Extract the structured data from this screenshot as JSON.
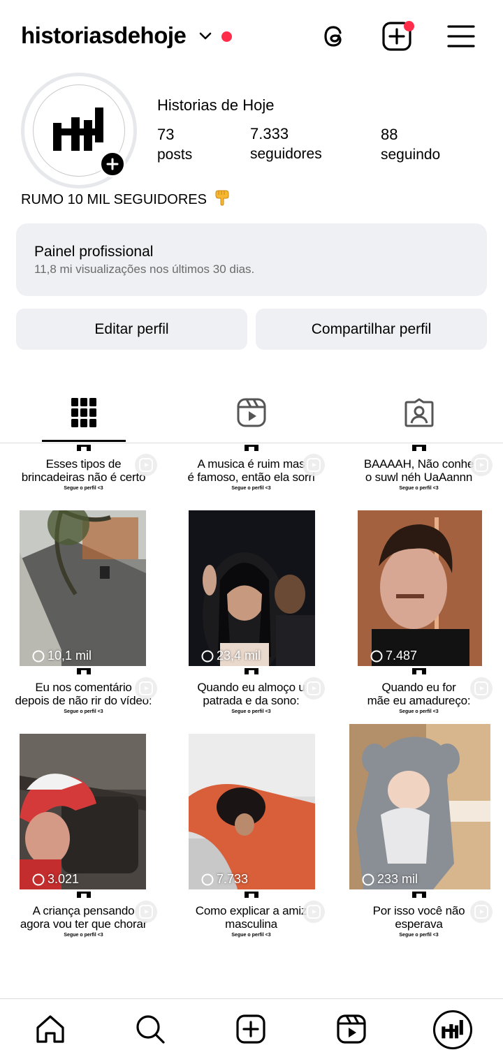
{
  "header": {
    "username": "historiasdehoje",
    "icons": [
      "chevron-down-icon",
      "threads-icon",
      "create-post-icon",
      "menu-icon"
    ],
    "notification_color": "#ff2d4a"
  },
  "profile": {
    "display_name": "Historias de Hoje",
    "stats": [
      {
        "value": "73",
        "label": "posts"
      },
      {
        "value": "7.333",
        "label": "seguidores"
      },
      {
        "value": "88",
        "label": "seguindo"
      }
    ],
    "bio": "RUMO 10 MIL SEGUIDORES",
    "bio_emoji": "pointing-down-hand-emoji"
  },
  "dashboard": {
    "title": "Painel profissional",
    "subtitle": "11,8 mi visualizações nos últimos 30 dias."
  },
  "actions": {
    "edit": "Editar perfil",
    "share": "Compartilhar perfil"
  },
  "tabs": [
    {
      "name": "grid-icon",
      "active": true
    },
    {
      "name": "reels-icon",
      "active": false
    },
    {
      "name": "tagged-icon",
      "active": false
    }
  ],
  "posts": [
    {
      "caption": "Esses tipos de\nbrincadeiras não é certo",
      "segue": "Segue o perfil <3",
      "views": "10,1 mil"
    },
    {
      "caption": "A musica é ruim mas\né famoso, então ela sorri",
      "segue": "Segue o perfil <3",
      "views": "23,4 mil"
    },
    {
      "caption": "BAAAAH, Não conhe\no suwl néh UaAannn",
      "segue": "Segue o perfil <3",
      "views": "7.487"
    },
    {
      "caption": "Eu nos comentário\ndepois de não rir do vídeo:",
      "segue": "Segue o perfil <3",
      "views": "3.021"
    },
    {
      "caption": "Quando eu almoço u\npatrada e da sono:",
      "segue": "Segue o perfil <3",
      "views": "7.733"
    },
    {
      "caption": "Quando eu for\nmãe eu amadureço:",
      "segue": "Segue o perfil <3",
      "views": "233 mil"
    },
    {
      "caption": "A criança pensando\nagora vou ter que chorar",
      "segue": "Segue o perfil <3",
      "views": ""
    },
    {
      "caption": "Como explicar a amiz\nmasculina",
      "segue": "Segue o perfil <3",
      "views": ""
    },
    {
      "caption": "Por isso você não\nesperava",
      "segue": "Segue o perfil <3",
      "views": ""
    }
  ],
  "bottom_nav": [
    "home-icon",
    "search-icon",
    "create-icon",
    "reels-icon",
    "profile-avatar"
  ]
}
